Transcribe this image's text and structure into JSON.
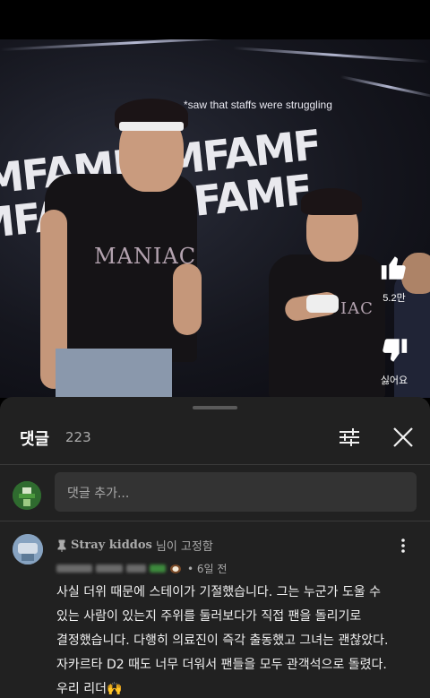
{
  "video": {
    "caption": "*saw that staffs were struggling",
    "brand_text": "MFAMFAMFAMF",
    "shirt_print_1": "MANIAC",
    "shirt_print_2": "IAC",
    "like_count": "5.2만",
    "dislike_label": "싫어요"
  },
  "comments_panel": {
    "title": "댓글",
    "count": "223",
    "input_placeholder": "댓글 추가...",
    "pinned": {
      "pinned_by": "Stray kiddos",
      "pinned_suffix": "님이 고정함",
      "time": "• 6일 전",
      "text": "사실 더위 때문에 스테이가 기절했습니다. 그는 누군가 도울 수\n있는 사람이 있는지 주위를 둘러보다가 직접 팬을 돌리기로\n결정했습니다. 다행히 의료진이 즉각 출동했고 그녀는 괜찮았다.\n자카르타 D2 때도 너무 더워서 팬들을 모두 관객석으로 돌렸다.\n우리 리더🙌"
    }
  }
}
